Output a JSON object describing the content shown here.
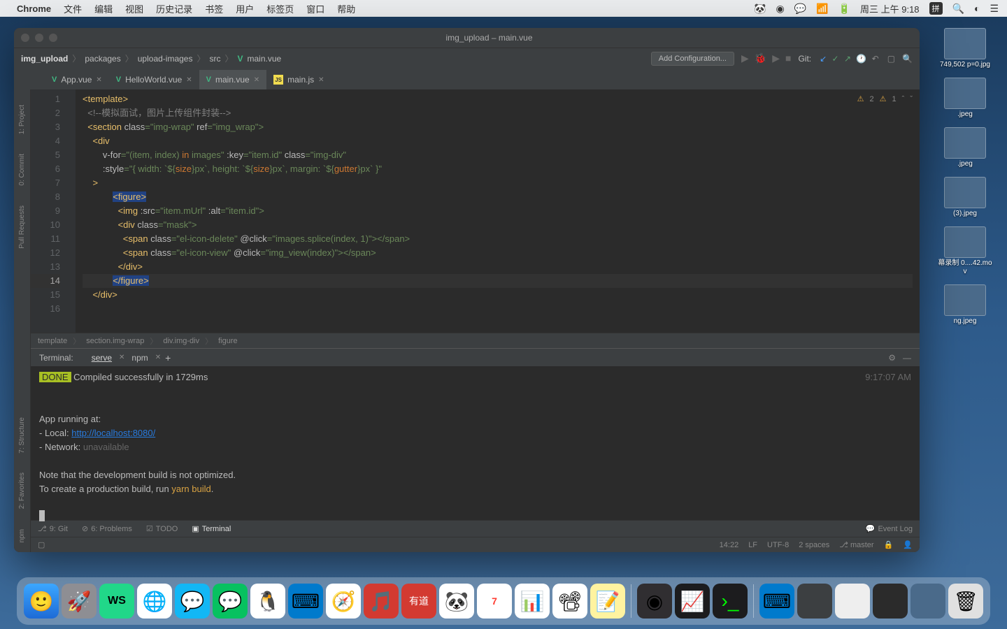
{
  "menubar": {
    "app": "Chrome",
    "items": [
      "文件",
      "编辑",
      "视图",
      "历史记录",
      "书签",
      "用户",
      "标签页",
      "窗口",
      "帮助"
    ],
    "right": {
      "datetime": "周三 上午 9:18",
      "ime": "拼"
    }
  },
  "ide": {
    "title": "img_upload – main.vue",
    "breadcrumbs": [
      "img_upload",
      "packages",
      "upload-images",
      "src",
      "main.vue"
    ],
    "add_configuration": "Add Configuration...",
    "git_label": "Git:",
    "tabs": [
      {
        "name": "App.vue",
        "type": "vue",
        "active": false
      },
      {
        "name": "HelloWorld.vue",
        "type": "vue",
        "active": false
      },
      {
        "name": "main.vue",
        "type": "vue",
        "active": true
      },
      {
        "name": "main.js",
        "type": "js",
        "active": false
      }
    ],
    "left_tools": [
      "1: Project",
      "0: Commit",
      "Pull Requests",
      "7: Structure",
      "2: Favorites",
      "npm"
    ],
    "inspections": {
      "warn2": "2",
      "warn1": "1"
    },
    "code_breadcrumb": [
      "template",
      "section.img-wrap",
      "div.img-div",
      "figure"
    ],
    "code_lines": {
      "l1": "<template>",
      "l2_comment": "<!--模拟面试，图片上传组件封装-->",
      "l3_a": "<section ",
      "l3_b": "class",
      "l3_c": "=\"img-wrap\" ",
      "l3_d": "ref",
      "l3_e": "=\"img_wrap\">",
      "l4": "<div",
      "l5_a": "v-for",
      "l5_b": "=\"(item, index) ",
      "l5_c": "in",
      "l5_d": " images\" ",
      "l5_e": ":key",
      "l5_f": "=\"item.id\" ",
      "l5_g": "class",
      "l5_h": "=\"img-div\"",
      "l6_a": ":style",
      "l6_b": "=\"{ width: `${",
      "l6_c": "size",
      "l6_d": "}px`, height: `${",
      "l6_e": "size",
      "l6_f": "}px`, margin: `${",
      "l6_g": "gutter",
      "l6_h": "}px` }\"",
      "l7": ">",
      "l8": "<figure>",
      "l9_a": "<img ",
      "l9_b": ":src",
      "l9_c": "=\"item.mUrl\" ",
      "l9_d": ":alt",
      "l9_e": "=\"item.id\">",
      "l10_a": "<div ",
      "l10_b": "class",
      "l10_c": "=\"mask\">",
      "l11_a": "<span ",
      "l11_b": "class",
      "l11_c": "=\"el-icon-delete\" ",
      "l11_d": "@click",
      "l11_e": "=\"images.splice(index, 1)\"></span>",
      "l12_a": "<span ",
      "l12_b": "class",
      "l12_c": "=\"el-icon-view\" ",
      "l12_d": "@click",
      "l12_e": "=\"img_view(index)\"></span>",
      "l13": "</div>",
      "l14": "</figure>",
      "l15": "</div>",
      "l16": ""
    },
    "terminal": {
      "label": "Terminal:",
      "tabs": [
        "serve",
        "npm"
      ],
      "done": "DONE",
      "compiled": " Compiled successfully in 1729ms",
      "time": "9:17:07 AM",
      "running": "App running at:",
      "local": "- Local:   ",
      "local_url": "http://localhost:8080/",
      "network": "- Network: ",
      "network_val": "unavailable",
      "note1": "Note that the development build is not optimized.",
      "note2a": "To create a production build, run ",
      "note2b": "yarn build",
      "note2c": "."
    },
    "tool_windows": {
      "git": "9: Git",
      "problems": "6: Problems",
      "todo": "TODO",
      "terminal": "Terminal",
      "event_log": "Event Log"
    },
    "statusbar": {
      "pos": "14:22",
      "lf": "LF",
      "encoding": "UTF-8",
      "indent": "2 spaces",
      "branch": "master"
    }
  },
  "desktop": {
    "files": [
      "749,502\np=0.jpg",
      ".jpeg",
      ".jpeg",
      "(3).jpeg",
      "幕录制\n0....42.mov",
      "ng.jpeg"
    ]
  }
}
